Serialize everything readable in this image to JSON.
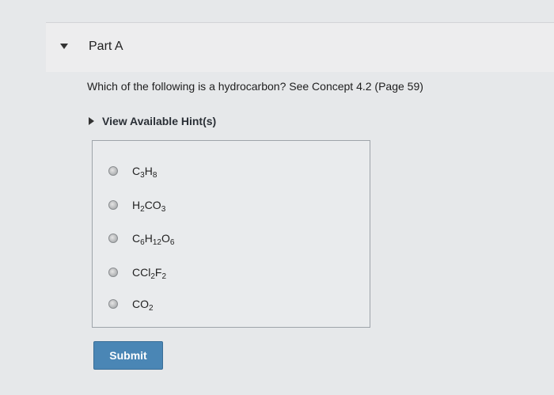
{
  "part": {
    "title": "Part A"
  },
  "question": {
    "text": "Which of the following is a hydrocarbon? See Concept 4.2 (Page 59)"
  },
  "hint": {
    "label": "View Available Hint(s)"
  },
  "choices": [
    {
      "label": "C3H8",
      "parts": [
        {
          "t": "C"
        },
        {
          "s": "3"
        },
        {
          "t": "H"
        },
        {
          "s": "8"
        }
      ]
    },
    {
      "label": "H2CO3",
      "parts": [
        {
          "t": "H"
        },
        {
          "s": "2"
        },
        {
          "t": "CO"
        },
        {
          "s": "3"
        }
      ]
    },
    {
      "label": "C6H12O6",
      "parts": [
        {
          "t": "C"
        },
        {
          "s": "6"
        },
        {
          "t": "H"
        },
        {
          "s": "12"
        },
        {
          "t": "O"
        },
        {
          "s": "6"
        }
      ]
    },
    {
      "label": "CCl2F2",
      "parts": [
        {
          "t": "CCl"
        },
        {
          "s": "2"
        },
        {
          "t": "F"
        },
        {
          "s": "2"
        }
      ]
    },
    {
      "label": "CO2",
      "parts": [
        {
          "t": "CO"
        },
        {
          "s": "2"
        }
      ]
    }
  ],
  "submit": {
    "label": "Submit"
  },
  "colors": {
    "accent": "#4a86b5",
    "background": "#e6e8ea"
  }
}
